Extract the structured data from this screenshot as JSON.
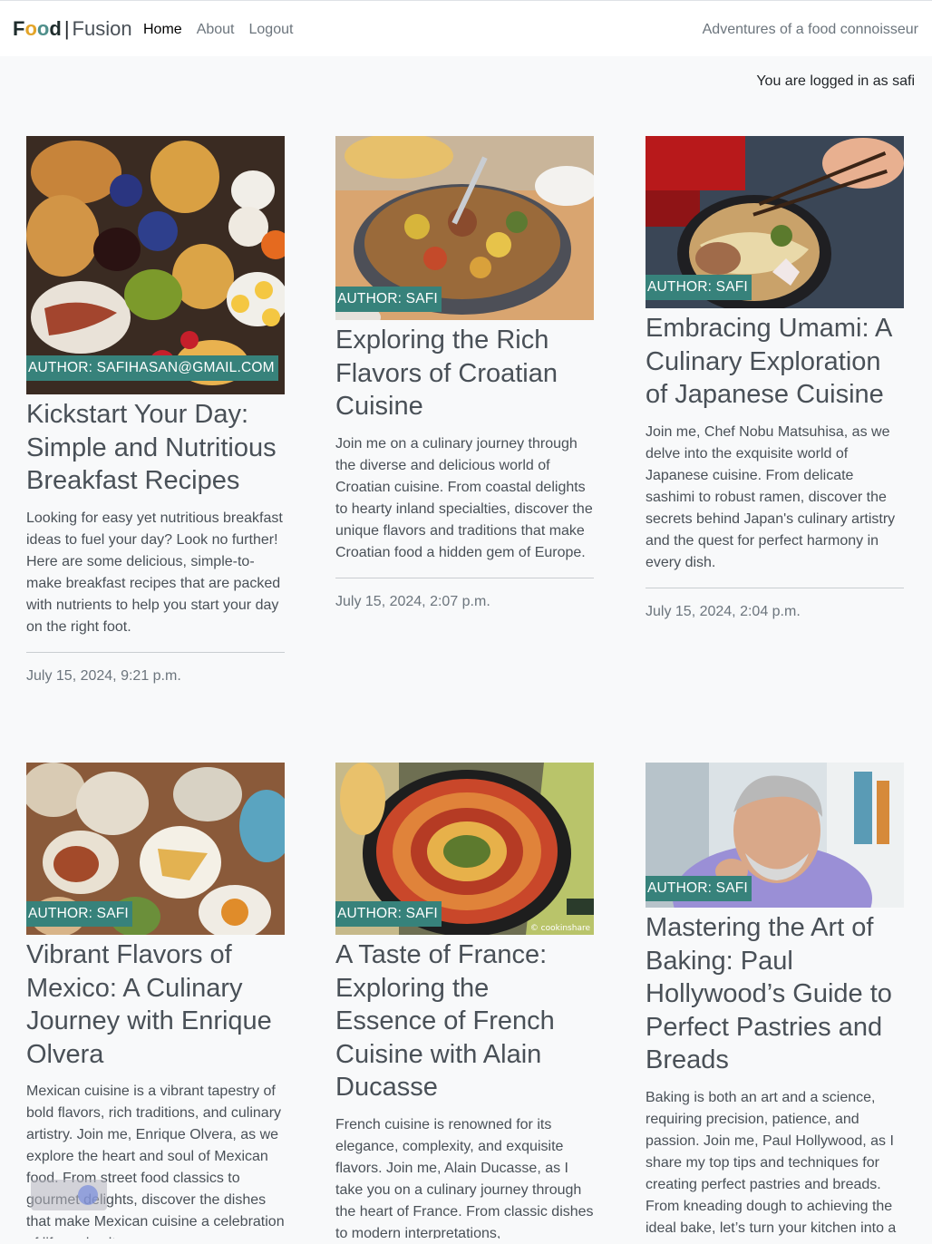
{
  "navbar": {
    "brand_food": "Food",
    "brand_sep": "|",
    "brand_fusion": "Fusion",
    "links": [
      "Home",
      "About",
      "Logout"
    ],
    "tagline": "Adventures of a food connoisseur"
  },
  "session": {
    "logged_in_text": "You are logged in as safi"
  },
  "posts": [
    {
      "author": "AUTHOR: SAFIHASAN@GMAIL.COM",
      "title": "Kickstart Your Day: Simple and Nutritious Breakfast Recipes",
      "excerpt": "Looking for easy yet nutritious breakfast ideas to fuel your day? Look no further! Here are some delicious, simple-to-make breakfast recipes that are packed with nutrients to help you start your day on the right foot.",
      "date": "July 15, 2024, 9:21 p.m."
    },
    {
      "author": "AUTHOR: SAFI",
      "title": "Exploring the Rich Flavors of Croatian Cuisine",
      "excerpt": "Join me on a culinary journey through the diverse and delicious world of Croatian cuisine. From coastal delights to hearty inland specialties, discover the unique flavors and traditions that make Croatian food a hidden gem of Europe.",
      "date": "July 15, 2024, 2:07 p.m."
    },
    {
      "author": "AUTHOR: SAFI",
      "title": "Embracing Umami: A Culinary Exploration of Japanese Cuisine",
      "excerpt": "Join me, Chef Nobu Matsuhisa, as we delve into the exquisite world of Japanese cuisine. From delicate sashimi to robust ramen, discover the secrets behind Japan's culinary artistry and the quest for perfect harmony in every dish.",
      "date": "July 15, 2024, 2:04 p.m."
    },
    {
      "author": "AUTHOR: SAFI",
      "title": "Vibrant Flavors of Mexico: A Culinary Journey with Enrique Olvera",
      "excerpt": "Mexican cuisine is a vibrant tapestry of bold flavors, rich traditions, and culinary artistry. Join me, Enrique Olvera, as we explore the heart and soul of Mexican food. From street food classics to gourmet delights, discover the dishes that make Mexican cuisine a celebration of life and culture."
    },
    {
      "author": "AUTHOR: SAFI",
      "title": "A Taste of France: Exploring the Essence of French Cuisine with Alain Ducasse",
      "excerpt": "French cuisine is renowned for its elegance, complexity, and exquisite flavors. Join me, Alain Ducasse, as I take you on a culinary journey through the heart of France. From classic dishes to modern interpretations,",
      "image_credit": "© cookinshare"
    },
    {
      "author": "AUTHOR: SAFI",
      "title": "Mastering the Art of Baking: Paul Hollywood’s Guide to Perfect Pastries and Breads",
      "excerpt": "Baking is both an art and a science, requiring precision, patience, and passion. Join me, Paul Hollywood, as I share my top tips and techniques for creating perfect pastries and breads. From kneading dough to achieving the ideal bake, let’s turn your kitchen into a"
    }
  ]
}
